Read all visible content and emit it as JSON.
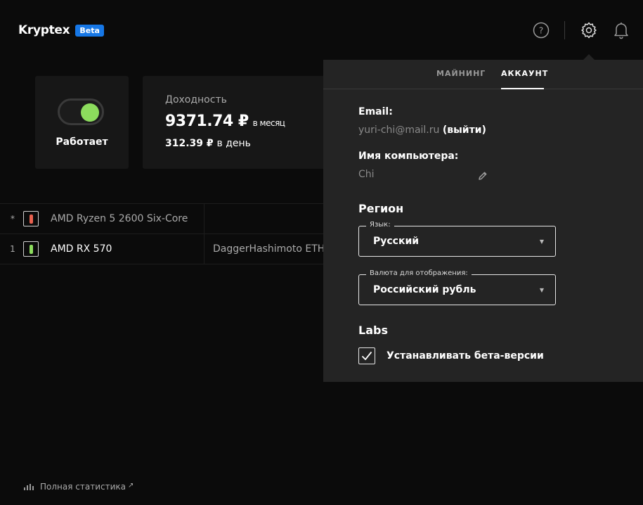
{
  "header": {
    "brand": "Kryptex",
    "badge": "Beta",
    "icons": [
      "help-icon",
      "gear-icon",
      "bell-icon"
    ]
  },
  "status": {
    "label": "Работает",
    "toggle_on": true,
    "toggle_color": "#8cdc5d"
  },
  "income": {
    "title": "Доходность",
    "month_value": "9371.74 ₽",
    "month_unit": "в месяц",
    "day_value": "312.39 ₽",
    "day_unit": "в день"
  },
  "devices": [
    {
      "index": "*",
      "name": "AMD Ryzen 5 2600 Six-Core",
      "algo": "",
      "color": "#e8614f"
    },
    {
      "index": "1",
      "name": "AMD RX 570",
      "algo": "DaggerHashimoto ETH",
      "color": "#8cdc5d"
    }
  ],
  "footer": {
    "stats_link": "Полная статистика"
  },
  "panel": {
    "tabs": [
      {
        "label": "МАЙНИНГ",
        "active": false
      },
      {
        "label": "АККАУНТ",
        "active": true
      }
    ],
    "email_label": "Email:",
    "email_value": "yuri-chi@mail.ru",
    "logout": "(выйти)",
    "pc_label": "Имя компьютера:",
    "pc_value": "Chi",
    "region_title": "Регион",
    "language": {
      "legend": "Язык:",
      "value": "Русский"
    },
    "currency": {
      "legend": "Валюта для отображения:",
      "value": "Российский рубль"
    },
    "labs_title": "Labs",
    "beta_checkbox": {
      "label": "Устанавливать бета-версии",
      "checked": true
    }
  }
}
